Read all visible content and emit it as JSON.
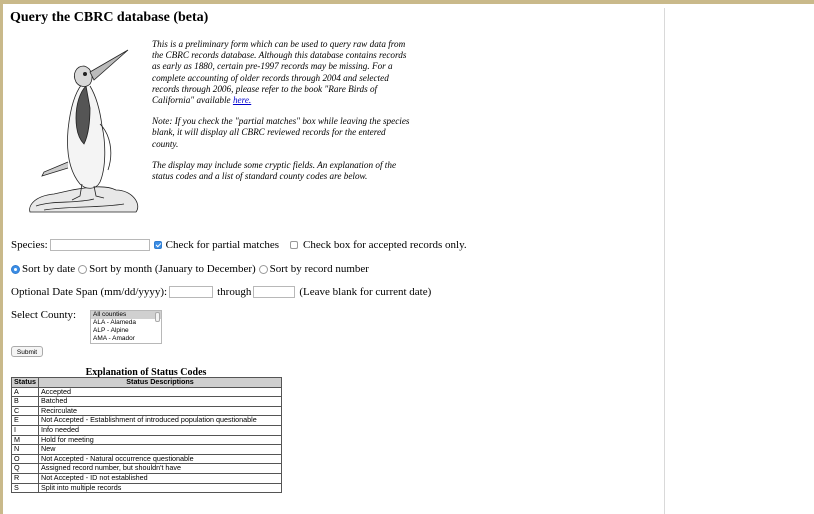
{
  "page": {
    "title": "Query the CBRC database (beta)"
  },
  "intro": {
    "p1": "This is a preliminary form which can be used to query raw data from the CBRC records database. Although this database contains records as early as 1880, certain pre-1997 records may be missing. For a complete accounting of older records through 2004 and selected records through 2006, please refer to the book \"Rare Birds of California\" available",
    "p1_link": "here.",
    "p2": "Note: If you check the \"partial matches\" box while leaving the species blank, it will display all CBRC reviewed records for the entered county.",
    "p3": "The display may include some cryptic fields. An explanation of the status codes and a list of standard county codes are below."
  },
  "form": {
    "species_label": "Species:",
    "species_value": "",
    "partial_label": "Check for partial matches",
    "partial_checked": true,
    "accepted_label": "Check box for accepted records only.",
    "accepted_checked": false,
    "sort_options": [
      {
        "label": "Sort by date",
        "selected": true
      },
      {
        "label": "Sort by month (January to December)",
        "selected": false
      },
      {
        "label": "Sort by record number",
        "selected": false
      }
    ],
    "date_label": "Optional Date Span (mm/dd/yyyy):",
    "date_from": "",
    "through_label": "through",
    "date_to": "",
    "date_note": "(Leave blank for current date)",
    "county_label": "Select County:",
    "county_options": [
      "All counties",
      "ALA - Alameda",
      "ALP - Alpine",
      "AMA - Amador"
    ],
    "county_selected": "All counties",
    "submit_label": "Submit"
  },
  "status_table": {
    "caption": "Explanation of Status Codes",
    "headers": [
      "Status",
      "Status Descriptions"
    ],
    "rows": [
      [
        "A",
        "Accepted"
      ],
      [
        "B",
        "Batched"
      ],
      [
        "C",
        "Recirculate"
      ],
      [
        "E",
        "Not Accepted - Establishment of introduced population questionable"
      ],
      [
        "I",
        "Info needed"
      ],
      [
        "M",
        "Hold for meeting"
      ],
      [
        "N",
        "New"
      ],
      [
        "O",
        "Not Accepted - Natural occurrence questionable"
      ],
      [
        "Q",
        "Assigned record number, but shouldn't have"
      ],
      [
        "R",
        "Not Accepted - ID not established"
      ],
      [
        "S",
        "Split into multiple records"
      ]
    ]
  },
  "colors": {
    "frame": "#c9b98a",
    "accent": "#3b8ee6",
    "link": "#0000cc"
  }
}
